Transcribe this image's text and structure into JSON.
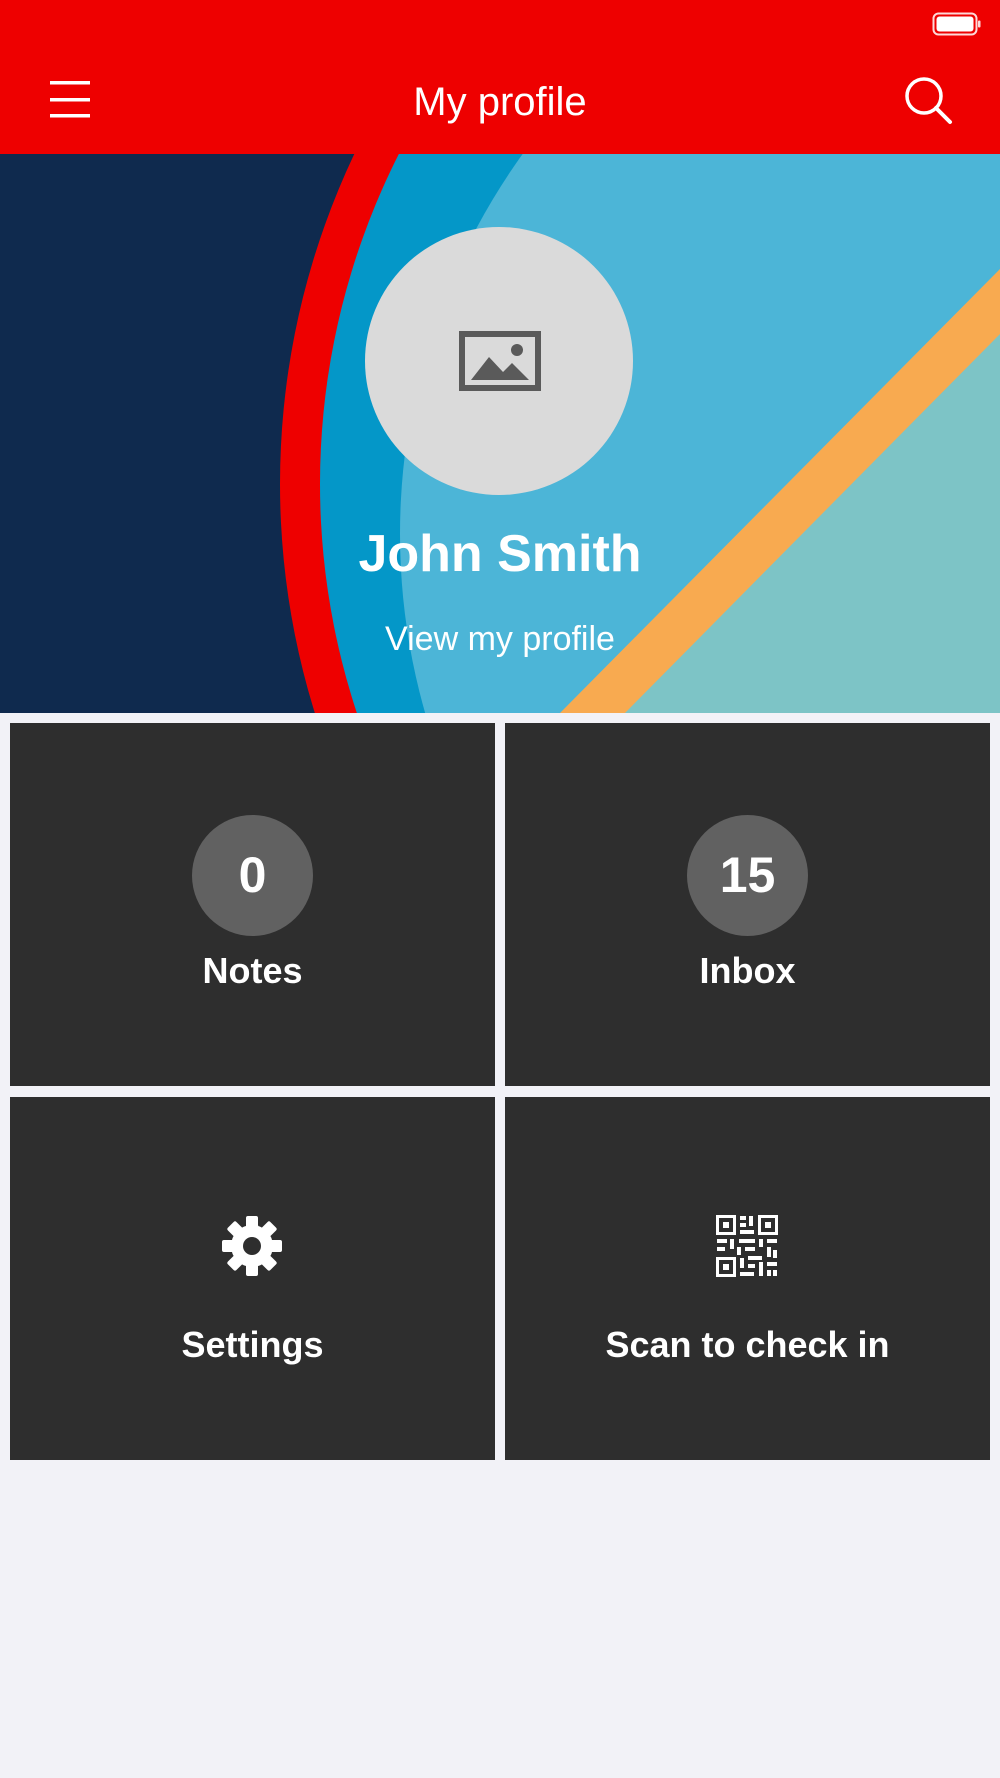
{
  "header": {
    "title": "My profile",
    "menu_icon": "hamburger-menu-icon",
    "search_icon": "search-icon",
    "battery_icon": "battery-icon"
  },
  "profile": {
    "name": "John Smith",
    "link": "View my profile",
    "avatar_icon": "image-placeholder-icon"
  },
  "tiles": [
    {
      "count": "0",
      "label": "Notes"
    },
    {
      "count": "15",
      "label": "Inbox"
    },
    {
      "label": "Settings",
      "icon": "gear-icon"
    },
    {
      "label": "Scan to check in",
      "icon": "qr-code-icon"
    }
  ],
  "colors": {
    "header": "#ee0000",
    "navy": "#0f2a4e",
    "blue": "#0497c8",
    "light_blue": "#4cb5d7",
    "orange": "#f8aa50",
    "teal": "#7dc4c6",
    "tile": "#2e2e2e",
    "badge": "#616161",
    "page_bg": "#f2f2f7"
  }
}
